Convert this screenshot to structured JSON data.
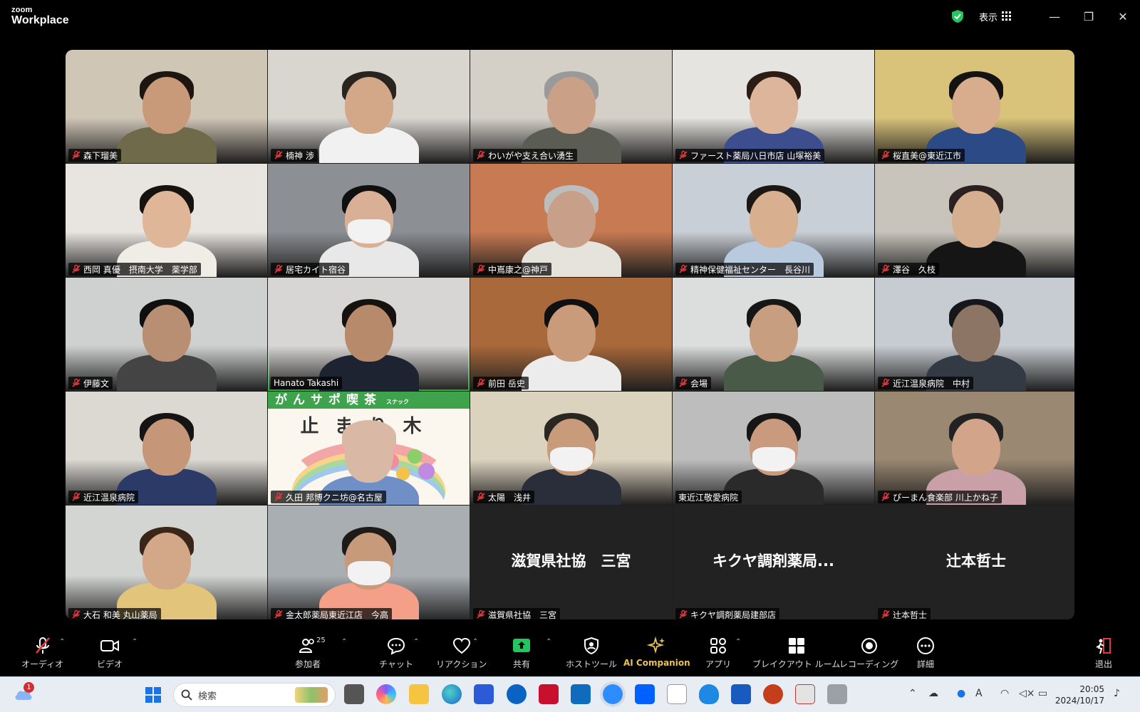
{
  "app": {
    "brand_top": "zoom",
    "brand_bottom": "Workplace",
    "view_label": "表示"
  },
  "participants": [
    {
      "name": "森下瑠美",
      "muted": true,
      "bg": "#cfc6b6",
      "skin": "#c89a7a",
      "hair": "#1c1510",
      "shirt": "#6e6a4a"
    },
    {
      "name": "楠神 渉",
      "muted": true,
      "bg": "#d9d6d0",
      "skin": "#d2a888",
      "hair": "#2a2420",
      "shirt": "#f1f1f1"
    },
    {
      "name": "わいがや支え合い湧生",
      "muted": true,
      "bg": "#d4d0c8",
      "skin": "#caa186",
      "hair": "#9a9a9a",
      "shirt": "#5b5d55"
    },
    {
      "name": "ファースト薬局八日市店 山塚裕美",
      "muted": true,
      "bg": "#e6e4e0",
      "skin": "#dcb59a",
      "hair": "#2b1d15",
      "shirt": "#3d4e8f"
    },
    {
      "name": "桜直美@東近江市",
      "muted": true,
      "bg": "#d9c27a",
      "skin": "#d8ad8d",
      "hair": "#151212",
      "shirt": "#2c4a86"
    },
    {
      "name": "西岡 真優　摂南大学　薬学部",
      "muted": true,
      "bg": "#e8e5e0",
      "skin": "#dfb697",
      "hair": "#161210",
      "shirt": "#f0ece6"
    },
    {
      "name": "居宅カイト宿谷",
      "muted": true,
      "bg": "#8c8f93",
      "skin": "#d9b095",
      "hair": "#101010",
      "shirt": "#e8e8e8",
      "masked": true
    },
    {
      "name": "中嶌康之@神戸",
      "muted": true,
      "bg": "#c87a52",
      "skin": "#c8a08a",
      "hair": "#bdbdbd",
      "shirt": "#e6e3dc"
    },
    {
      "name": "精神保健福祉センター　長谷川",
      "muted": true,
      "bg": "#c9cfd6",
      "skin": "#d8b090",
      "hair": "#1b1714",
      "shirt": "#b9c9de"
    },
    {
      "name": "澤谷　久枝",
      "muted": true,
      "bg": "#c8c4bc",
      "skin": "#d6ae90",
      "hair": "#2a2020",
      "shirt": "#151515"
    },
    {
      "name": "伊藤文",
      "muted": true,
      "bg": "#cfd1d0",
      "skin": "#b98f73",
      "hair": "#0f0f0f",
      "shirt": "#444"
    },
    {
      "name": "Hanato Takashi",
      "muted": false,
      "bg": "#d8d6d4",
      "skin": "#b78a6c",
      "hair": "#151210",
      "shirt": "#1d2330",
      "active": true
    },
    {
      "name": "前田 岳史",
      "muted": true,
      "bg": "#a9693a",
      "skin": "#c99b7a",
      "hair": "#101010",
      "shirt": "#ececec"
    },
    {
      "name": "会場",
      "muted": true,
      "bg": "#dcdedd",
      "skin": "#c89e80",
      "hair": "#161616",
      "shirt": "#4a5a48"
    },
    {
      "name": "近江温泉病院　中村",
      "muted": true,
      "bg": "#c7ccd2",
      "skin": "#8c7565",
      "hair": "#15171a",
      "shirt": "#333a44"
    },
    {
      "name": "近江温泉病院",
      "muted": true,
      "bg": "#dcd9d3",
      "skin": "#c69678",
      "hair": "#141414",
      "shirt": "#2b3a66"
    },
    {
      "name": "久田 邦博クニ坊@名古屋",
      "muted": true,
      "bg": "#f6f1e6",
      "skin": "#d9b8a6",
      "hair": "#d9b8a6",
      "shirt": "#6f8fc6",
      "poster": true
    },
    {
      "name": "太陽　浅井",
      "muted": true,
      "bg": "#dcd3bf",
      "skin": "#c89c7b",
      "hair": "#2a2622",
      "shirt": "#2a2d3a",
      "masked": true
    },
    {
      "name": "東近江敬愛病院",
      "muted": false,
      "bg": "#bdbdbd",
      "skin": "#c99a7d",
      "hair": "#161616",
      "shirt": "#2a2a2a",
      "masked": true
    },
    {
      "name": "ぴーまん食楽部 川上かね子",
      "muted": true,
      "bg": "#9a8872",
      "skin": "#d2a58a",
      "hair": "#222",
      "shirt": "#caa0a8"
    },
    {
      "name": "大石 和美 丸山薬局",
      "muted": true,
      "bg": "#d3d5d2",
      "skin": "#d3a888",
      "hair": "#3a2618",
      "shirt": "#e2c47a"
    },
    {
      "name": "金太郎薬局東近江店　今高",
      "muted": true,
      "bg": "#a9aeb2",
      "skin": "#c89a7c",
      "hair": "#1d1a17",
      "shirt": "#f4a088",
      "masked": true
    },
    {
      "name": "滋賀県社協　三宮",
      "display": "滋賀県社協　三宮",
      "muted": true,
      "videoOff": true
    },
    {
      "name": "キクヤ調剤薬局建部店",
      "display": "キクヤ調剤薬局...",
      "muted": true,
      "videoOff": true
    },
    {
      "name": "辻本哲士",
      "display": "辻本哲士",
      "muted": true,
      "videoOff": true
    }
  ],
  "poster": {
    "line1": "がんサポ喫茶",
    "line2": "止まり木",
    "tag": "スナック"
  },
  "toolbar": {
    "audio": "オーディオ",
    "video": "ビデオ",
    "participants": "参加者",
    "participants_count": "25",
    "chat": "チャット",
    "reactions": "リアクション",
    "share": "共有",
    "host_tools": "ホストツール",
    "ai": "AI Companion",
    "apps": "アプリ",
    "breakout": "ブレイクアウト ルーム",
    "record": "レコーディング",
    "more": "詳細",
    "leave": "退出"
  },
  "taskbar": {
    "search_placeholder": "検索",
    "time": "20:05",
    "date": "2024/10/17",
    "badge": "1"
  },
  "colors": {
    "active_border": "#3ddc5a",
    "muted_red": "#e5383b",
    "ai_gold": "#e8c45a",
    "share_green": "#22c55e"
  }
}
